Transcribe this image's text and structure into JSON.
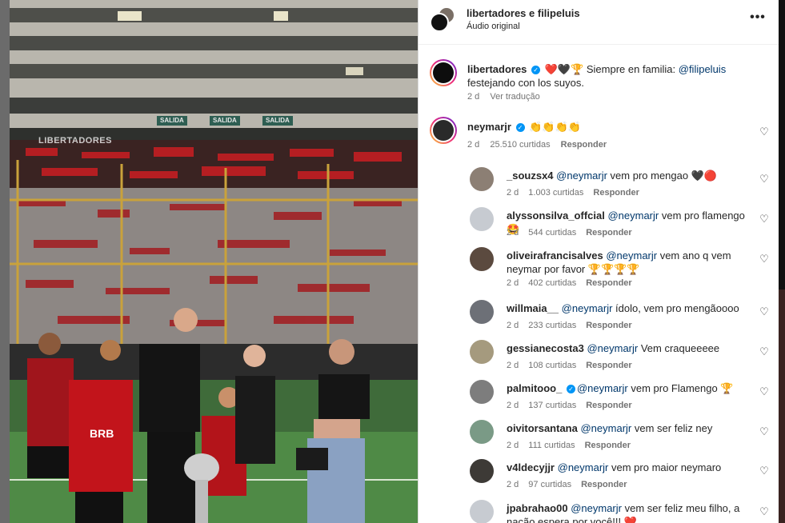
{
  "header": {
    "title": "libertadores e filipeluis",
    "subtitle": "Áudio original",
    "more_icon": "more-horizontal-icon"
  },
  "media": {
    "watermark": "LIBERTADORES",
    "signs": [
      "SALIDA",
      "SALIDA",
      "SALIDA"
    ],
    "shirt_sponsor": "BRB"
  },
  "caption": {
    "username": "libertadores",
    "emojis": "❤️🖤🏆",
    "text_before": "Siempre en familia: ",
    "mention": "@filipeluis",
    "text_after": " festejando con los suyos.",
    "time": "2 d",
    "translate": "Ver tradução"
  },
  "top_comment": {
    "username": "neymarjr",
    "text": "👏👏👏👏",
    "time": "2 d",
    "likes": "25.510 curtidas",
    "reply": "Responder"
  },
  "replies": [
    {
      "username": "_souzsx4",
      "mention": "@neymarjr",
      "text": " vem pro mengao 🖤🔴",
      "time": "2 d",
      "likes": "1.003 curtidas",
      "reply": "Responder",
      "verified": false,
      "color": "#8c7f74"
    },
    {
      "username": "alyssonsilva_offcial",
      "mention": "@neymarjr",
      "text": " vem pro flamengo 🤩",
      "time": "2 d",
      "likes": "544 curtidas",
      "reply": "Responder",
      "verified": false,
      "color": "#c7cbd1"
    },
    {
      "username": "oliveirafrancisalves",
      "mention": "@neymarjr",
      "text": " vem ano q vem neymar por favor 🏆🏆🏆🏆",
      "time": "2 d",
      "likes": "402 curtidas",
      "reply": "Responder",
      "verified": false,
      "color": "#5b4a3f"
    },
    {
      "username": "willmaia__",
      "mention": "@neymarjr",
      "text": " ídolo, vem pro mengãoooo",
      "time": "2 d",
      "likes": "233 curtidas",
      "reply": "Responder",
      "verified": false,
      "color": "#6d7077"
    },
    {
      "username": "gessianecosta3",
      "mention": "@neymarjr",
      "text": " Vem craqueeeee",
      "time": "2 d",
      "likes": "108 curtidas",
      "reply": "Responder",
      "verified": false,
      "color": "#a59a7e"
    },
    {
      "username": "palmitooo_",
      "mention": "@neymarjr",
      "text": " vem pro Flamengo 🏆",
      "time": "2 d",
      "likes": "137 curtidas",
      "reply": "Responder",
      "verified": true,
      "color": "#7d7d7d"
    },
    {
      "username": "oivitorsantana",
      "mention": "@neymarjr",
      "text": " vem ser feliz ney",
      "time": "2 d",
      "likes": "111 curtidas",
      "reply": "Responder",
      "verified": false,
      "color": "#7a9a86"
    },
    {
      "username": "v4ldecyjjr",
      "mention": "@neymarjr",
      "text": " vem pro maior neymaro",
      "time": "2 d",
      "likes": "97 curtidas",
      "reply": "Responder",
      "verified": false,
      "color": "#3d3a36"
    },
    {
      "username": "jpabrahao00",
      "mention": "@neymarjr",
      "text": " vem ser feliz meu filho, a nação espera por você!!! ❤️",
      "time": "",
      "likes": "",
      "reply": "",
      "verified": false,
      "color": "#c7cbd1"
    }
  ],
  "icons": {
    "like": "heart-icon",
    "verified": "verified-badge-icon"
  }
}
